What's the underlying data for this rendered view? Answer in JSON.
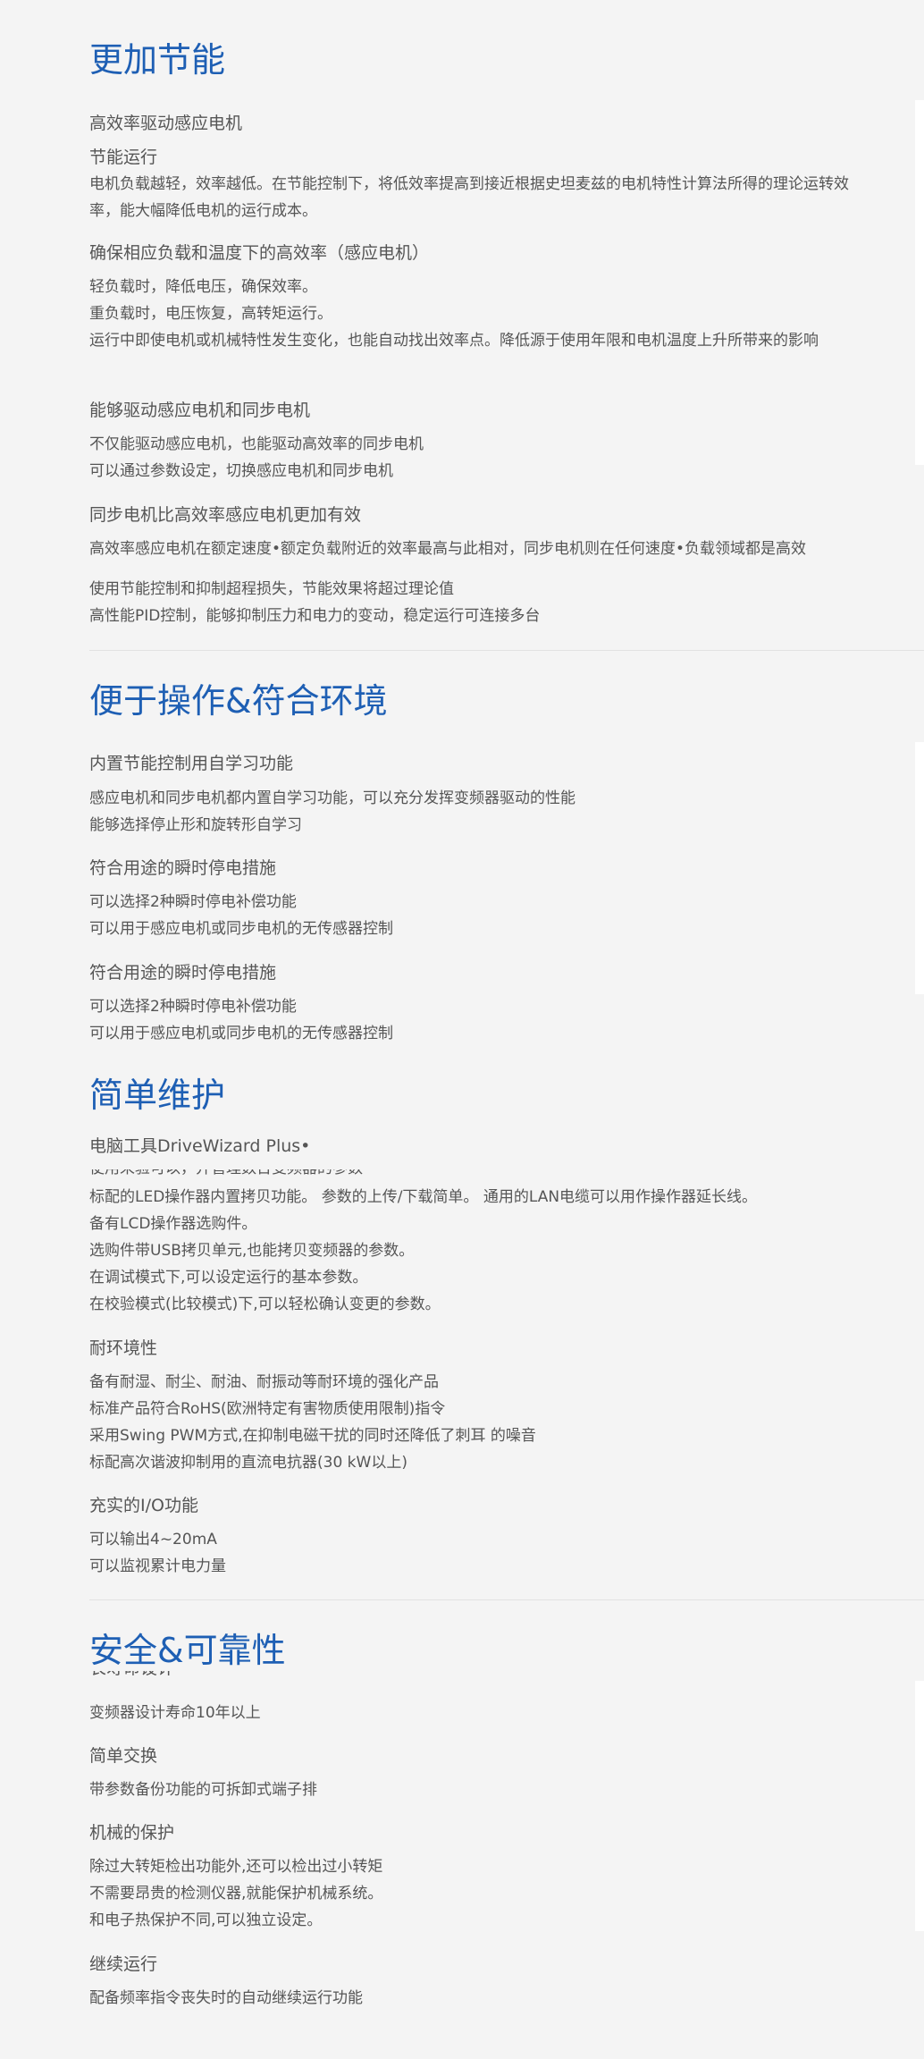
{
  "sections": [
    {
      "title": "更加节能",
      "items": [
        {
          "subtitle": "高效率驱动感应电机",
          "lines": []
        },
        {
          "subtitle": "节能运行",
          "lines": [
            "电机负载越轻，效率越低。在节能控制下，将低效率提高到接近根据史坦麦兹的电机特性计算法所得的理论运转效率，能大幅降低电机的运行成本。"
          ]
        },
        {
          "subtitle": "确保相应负载和温度下的高效率（感应电机）",
          "lines": [
            "轻负载时，降低电压，确保效率。",
            "重负载时，电压恢复，高转矩运行。",
            "运行中即使电机或机械特性发生变化，也能自动找出效率点。降低源于使用年限和电机温度上升所带来的影响"
          ]
        },
        {
          "subtitle": "能够驱动感应电机和同步电机",
          "lines": [
            "不仅能驱动感应电机，也能驱动高效率的同步电机",
            "可以通过参数设定，切换感应电机和同步电机"
          ]
        },
        {
          "subtitle": "同步电机比高效率感应电机更加有效",
          "lines": [
            "高效率感应电机在额定速度•额定负载附近的效率最高与此相对，同步电机则在任何速度•负载领域都是高效"
          ]
        },
        {
          "subtitle": "",
          "lines": [
            "使用节能控制和抑制超程损失，节能效果将超过理论值",
            "高性能PID控制，能够抑制压力和电力的变动，稳定运行可连接多台"
          ]
        }
      ]
    },
    {
      "title": "便于操作&符合环境",
      "items": [
        {
          "subtitle": "内置节能控制用自学习功能",
          "lines": [
            "感应电机和同步电机都内置自学习功能，可以充分发挥变频器驱动的性能",
            "能够选择停止形和旋转形自学习"
          ]
        },
        {
          "subtitle": "符合用途的瞬时停电措施",
          "lines": [
            "可以选择2种瞬时停电补偿功能",
            "可以用于感应电机或同步电机的无传感器控制"
          ]
        },
        {
          "subtitle": "符合用途的瞬时停电措施",
          "lines": [
            "可以选择2种瞬时停电补偿功能",
            "可以用于感应电机或同步电机的无传感器控制"
          ]
        }
      ]
    },
    {
      "title": "简单维护",
      "items": [
        {
          "subtitle": "电脑工具DriveWizard Plus•",
          "clipped_line": "使用来验可以，并管理数台变频器的参数",
          "lines": [
            "标配的LED操作器内置拷贝功能。 参数的上传/下载简单。 通用的LAN电缆可以用作操作器延长线。",
            "备有LCD操作器选购件。",
            "选购件带USB拷贝单元,也能拷贝变频器的参数。",
            "在调试模式下,可以设定运行的基本参数。",
            "在校验模式(比较模式)下,可以轻松确认变更的参数。"
          ]
        },
        {
          "subtitle": "耐环境性",
          "lines": [
            "备有耐湿、耐尘、耐油、耐振动等耐环境的强化产品",
            "标准产品符合RoHS(欧洲特定有害物质使用限制)指令",
            "采用Swing PWM方式,在抑制电磁干扰的同时还降低了刺耳 的噪音",
            "标配高次谐波抑制用的直流电抗器(30 kW以上)"
          ]
        },
        {
          "subtitle": "充实的I/O功能",
          "lines": [
            "可以输出4~20mA",
            "可以监视累计电力量"
          ]
        }
      ]
    },
    {
      "title": "安全&可靠性",
      "items": [
        {
          "subtitle": "",
          "clipped_top": "长寿命设计",
          "lines": [
            "变频器设计寿命10年以上"
          ]
        },
        {
          "subtitle": "简单交换",
          "lines": [
            "带参数备份功能的可拆卸式端子排"
          ]
        },
        {
          "subtitle": "机械的保护",
          "lines": [
            "除过大转矩检出功能外,还可以检出过小转矩",
            "不需要昂贵的检测仪器,就能保护机械系统。",
            "和电子热保护不同,可以独立设定。"
          ]
        },
        {
          "subtitle": "继续运行",
          "lines": [
            "配备频率指令丧失时的自动继续运行功能"
          ]
        }
      ]
    }
  ],
  "colors": {
    "background": "#f4f4f4",
    "title": "#1e5fb4",
    "text": "#555555",
    "divider": "#e2e2e2"
  }
}
